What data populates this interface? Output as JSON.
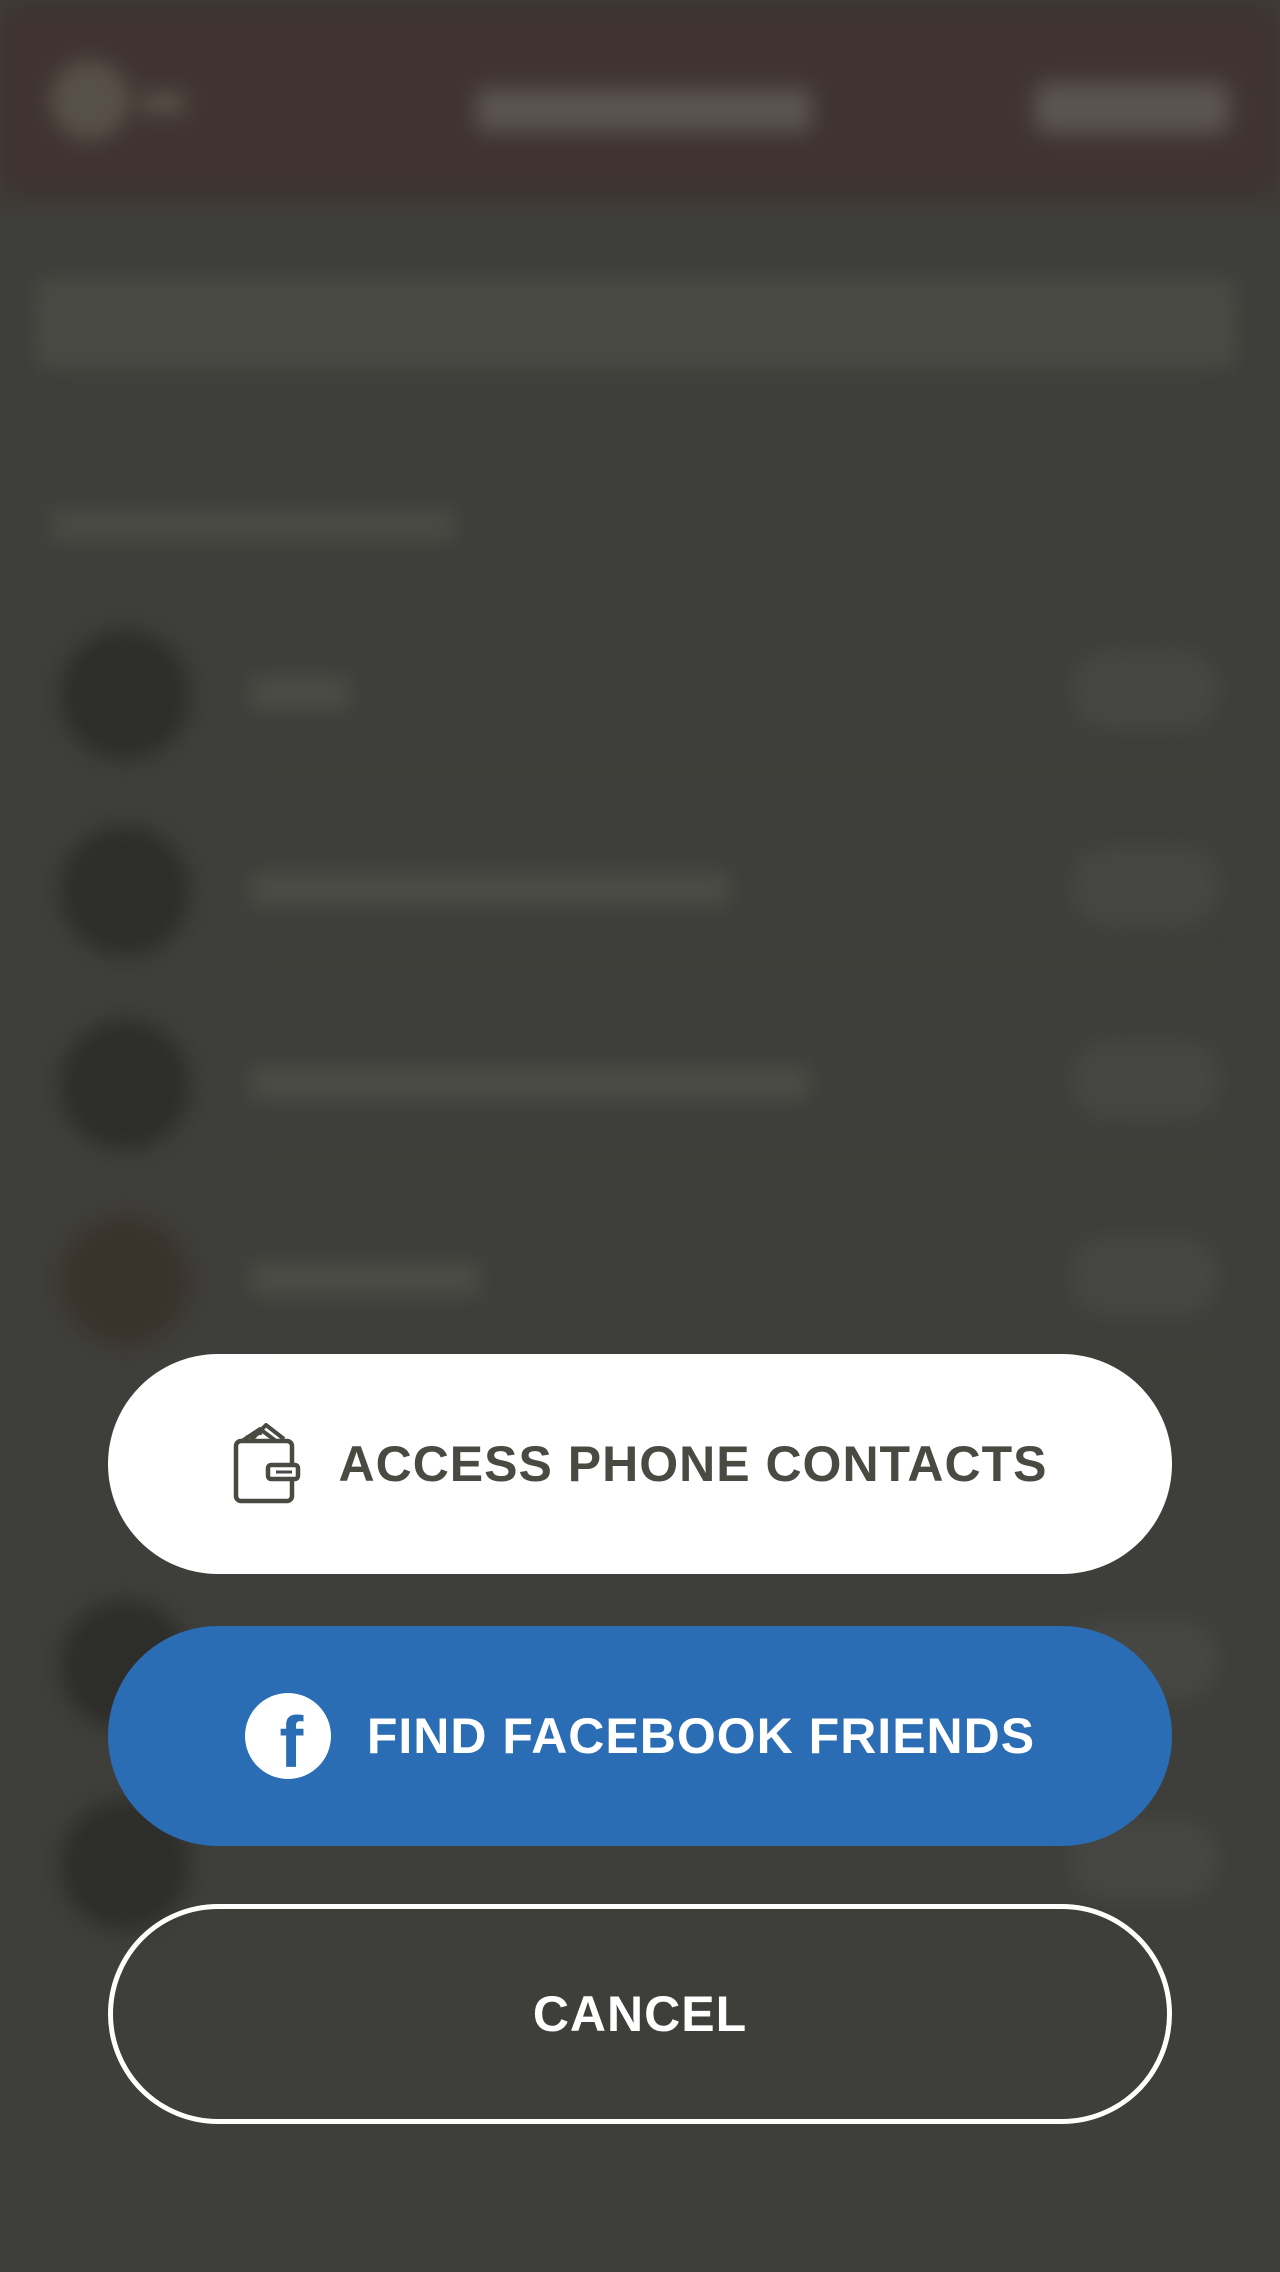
{
  "actions": {
    "access_contacts": {
      "label": "ACCESS PHONE CONTACTS",
      "icon": "wallet-icon"
    },
    "facebook": {
      "label": "FIND FACEBOOK FRIENDS",
      "icon": "facebook-icon",
      "icon_glyph": "f"
    },
    "cancel": {
      "label": "CANCEL"
    }
  },
  "colors": {
    "overlay": "#3e3e3a",
    "facebook_blue": "#2b6db5",
    "contacts_text": "#4a4a43",
    "white": "#ffffff"
  }
}
